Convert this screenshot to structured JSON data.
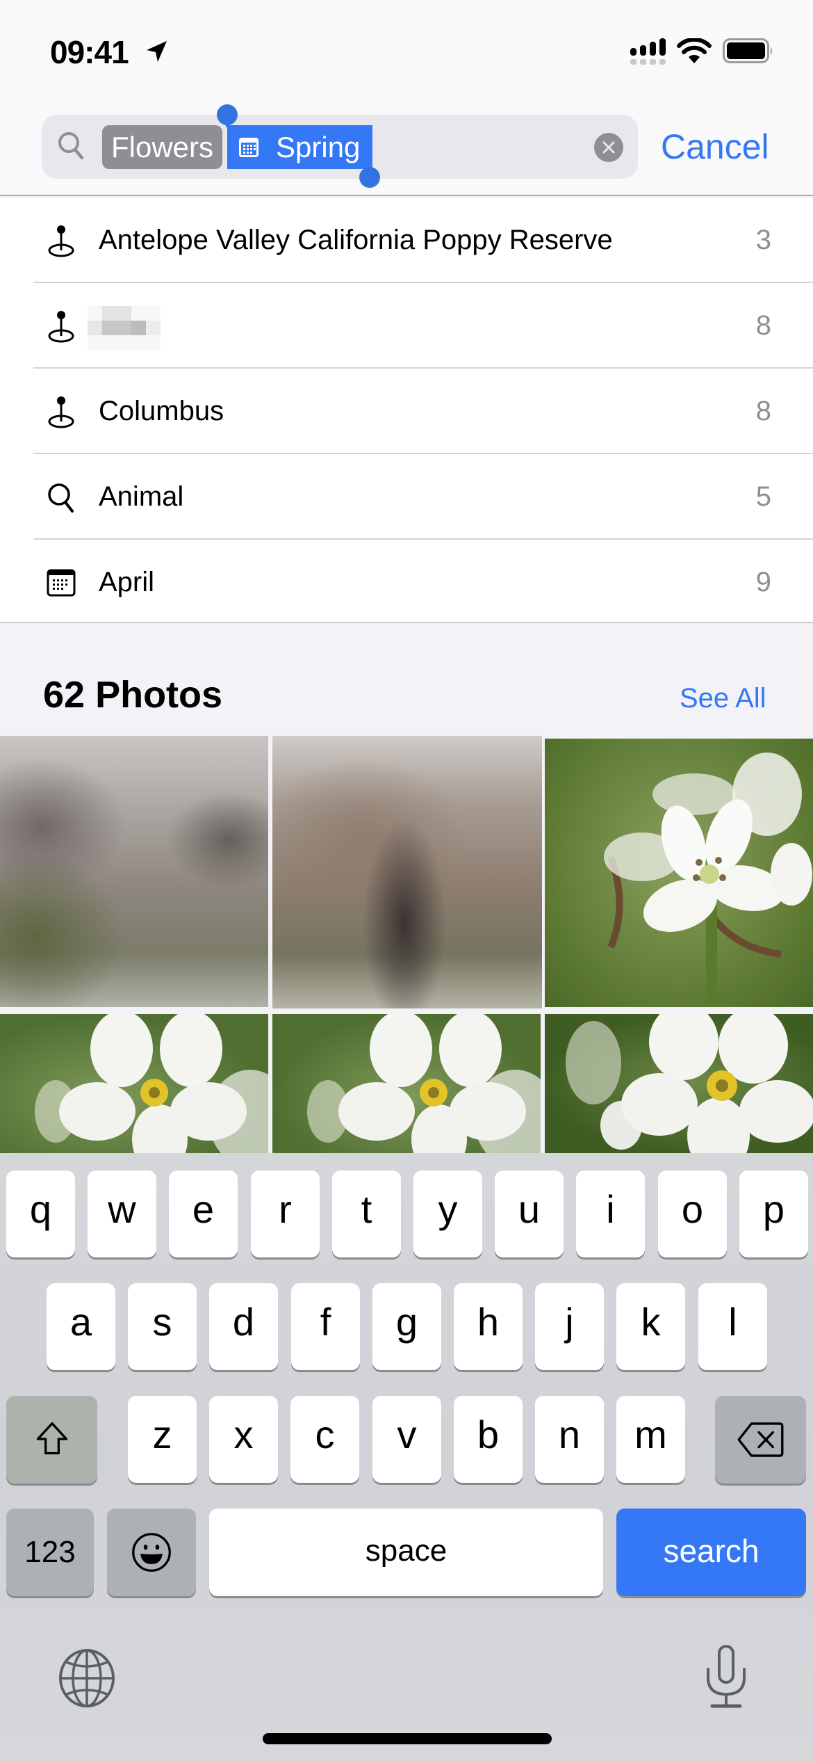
{
  "status_bar": {
    "time": "09:41",
    "icons": [
      "location-arrow-icon",
      "cellular-signal-icon",
      "wifi-icon",
      "battery-icon"
    ]
  },
  "search": {
    "icon": "search-icon",
    "tokens": [
      {
        "label": "Flowers",
        "icon": null,
        "selected": false
      },
      {
        "label": "Spring",
        "icon": "calendar-icon",
        "selected": true
      }
    ],
    "text_value": "",
    "clear_icon": "clear-circle-icon",
    "cancel_label": "Cancel"
  },
  "suggestions": [
    {
      "icon": "location-pin-icon",
      "label": "Antelope Valley California Poppy Reserve",
      "count": "3",
      "redacted": false
    },
    {
      "icon": "location-pin-icon",
      "label": "",
      "count": "8",
      "redacted": true
    },
    {
      "icon": "location-pin-icon",
      "label": "Columbus",
      "count": "8",
      "redacted": false
    },
    {
      "icon": "search-icon",
      "label": "Animal",
      "count": "5",
      "redacted": false
    },
    {
      "icon": "calendar-icon",
      "label": "April",
      "count": "9",
      "redacted": false
    }
  ],
  "photos": {
    "title": "62 Photos",
    "see_all_label": "See All",
    "thumbnails": [
      {
        "content": "pixelated/redacted photo"
      },
      {
        "content": "pixelated/redacted photo"
      },
      {
        "content": "white flower with stamens, green background"
      },
      {
        "content": "white five-petal flower with yellow center"
      },
      {
        "content": "white five-petal flower with yellow center"
      },
      {
        "content": "white five-petal flower with yellow center"
      }
    ]
  },
  "keyboard": {
    "row1": [
      "q",
      "w",
      "e",
      "r",
      "t",
      "y",
      "u",
      "i",
      "o",
      "p"
    ],
    "row2": [
      "a",
      "s",
      "d",
      "f",
      "g",
      "h",
      "j",
      "k",
      "l"
    ],
    "row3": [
      "z",
      "x",
      "c",
      "v",
      "b",
      "n",
      "m"
    ],
    "numbers_label": "123",
    "space_label": "space",
    "search_label": "search",
    "icons": [
      "shift-icon",
      "delete-icon",
      "emoji-icon",
      "globe-icon",
      "microphone-icon"
    ]
  },
  "colors": {
    "accent": "#3478f6",
    "token_gray": "#8e8e93",
    "secondary_text": "#8e8e93"
  }
}
